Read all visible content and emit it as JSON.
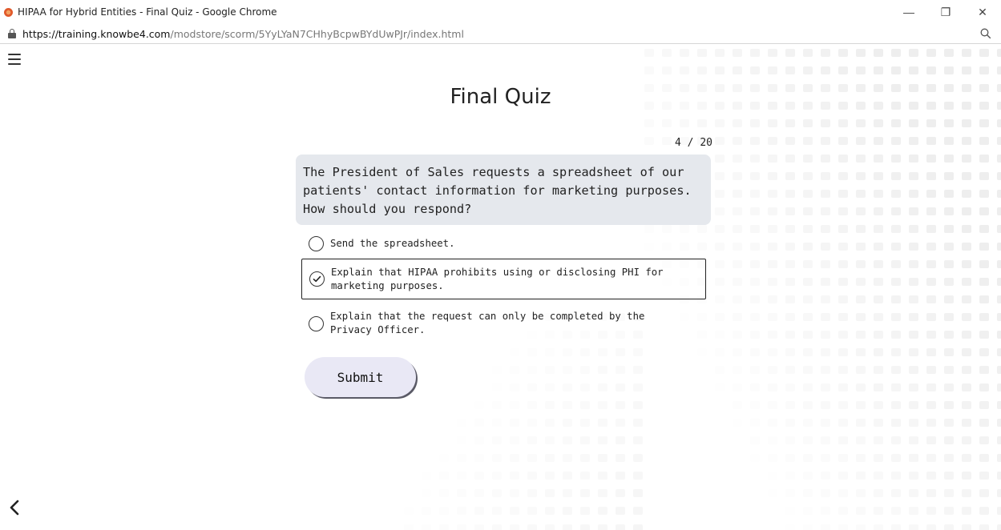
{
  "browser": {
    "window_title": "HIPAA for Hybrid Entities - Final Quiz - Google Chrome",
    "url_host": "https://training.knowbe4.com",
    "url_path": "/modstore/scorm/5YyLYaN7CHhyBcpwBYdUwPJr/index.html",
    "controls": {
      "minimize": "—",
      "restore": "❐",
      "close": "✕"
    }
  },
  "page": {
    "title": "Final Quiz",
    "progress": "4 / 20",
    "question": "The President of Sales requests a spreadsheet of our patients' contact information for marketing purposes. How should you respond?",
    "options": [
      {
        "label": "Send the spreadsheet.",
        "selected": false
      },
      {
        "label": "Explain that HIPAA prohibits using or disclosing PHI for marketing purposes.",
        "selected": true
      },
      {
        "label": "Explain that the request can only be completed by the Privacy Officer.",
        "selected": false
      }
    ],
    "submit_label": "Submit"
  },
  "icons": {
    "menu": "hamburger-menu-icon",
    "back": "chevron-left-icon",
    "lock": "lock-icon",
    "zoom": "magnifier-icon",
    "check": "checkmark-icon"
  },
  "colors": {
    "question_bg": "#e5e8ed",
    "submit_bg": "#e9e8f5",
    "pattern": "#eeeeee"
  }
}
